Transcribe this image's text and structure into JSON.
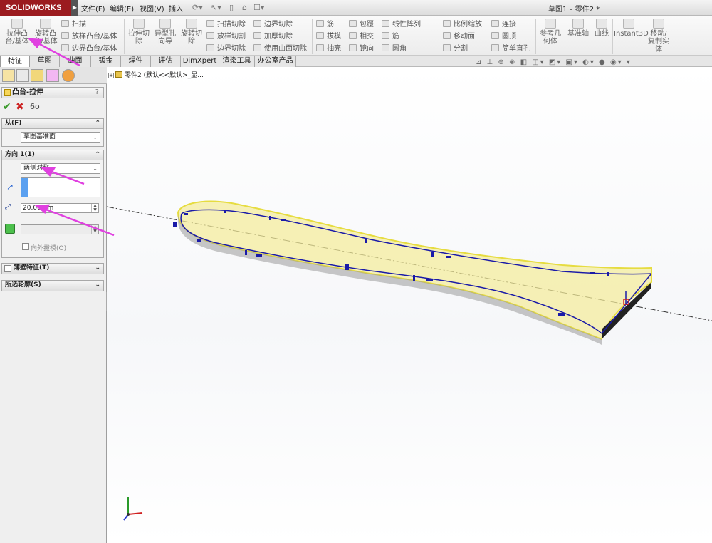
{
  "app": {
    "brand": "SOLIDWORKS",
    "doc_title": "草图1 – 零件2 *"
  },
  "menu": [
    {
      "label": "文件(F)"
    },
    {
      "label": "编辑(E)"
    },
    {
      "label": "视图(V)"
    },
    {
      "label": "插入"
    }
  ],
  "ribbon": {
    "big_buttons": [
      {
        "label1": "拉伸凸",
        "label2": "台/基体"
      },
      {
        "label1": "旋转凸",
        "label2": "台/基体"
      },
      {
        "label1": "拉伸切",
        "label2": "除"
      },
      {
        "label1": "异型孔",
        "label2": "向导"
      },
      {
        "label1": "旋转切",
        "label2": "除"
      },
      {
        "label1": "参考几",
        "label2": "何体"
      },
      {
        "label1": "基准轴",
        "label2": ""
      },
      {
        "label1": "曲线",
        "label2": ""
      },
      {
        "label1": "Instant3D",
        "label2": ""
      },
      {
        "label1": "移动/",
        "label2": "复制实",
        "label3": "体"
      }
    ],
    "small_buttons": [
      "扫描",
      "放样凸台/基体",
      "边界凸台/基体",
      "扫描切除",
      "放样切割",
      "边界切除",
      "边界切除",
      "加厚切除",
      "使用曲面切除",
      "筋",
      "拔模",
      "抽壳",
      "包覆",
      "相交",
      "镜向",
      "线性阵列",
      "筋",
      "圆角",
      "比例缩放",
      "移动面",
      "分割",
      "连接",
      "圆顶",
      "简单直孔"
    ]
  },
  "tabs": [
    {
      "label": "特征",
      "active": true
    },
    {
      "label": "草图"
    },
    {
      "label": "曲面"
    },
    {
      "label": "钣金"
    },
    {
      "label": "焊件"
    },
    {
      "label": "评估"
    },
    {
      "label": "DimXpert"
    },
    {
      "label": "渲染工具"
    },
    {
      "label": "办公室产品"
    }
  ],
  "property_manager": {
    "title": "凸台-拉伸",
    "help": "?",
    "from_group": {
      "title": "从(F)",
      "value": "草图基准面"
    },
    "direction_group": {
      "title": "方向 1(1)",
      "end_condition": "两侧对称",
      "depth_value": "20.00mm",
      "draft_label": "向外拔模(O)"
    },
    "thin_feature": {
      "title": "薄壁特征(T)"
    },
    "selected_contours": {
      "title": "所选轮廓(S)"
    }
  },
  "tree": {
    "label": "零件2 (默认<<默认>_显..."
  },
  "colors": {
    "brand_red": "#9b1b1f",
    "sketch_blue": "#1a1aa8",
    "extrude_yellow": "#f4ec9a",
    "annotation_magenta": "#e040e0"
  }
}
